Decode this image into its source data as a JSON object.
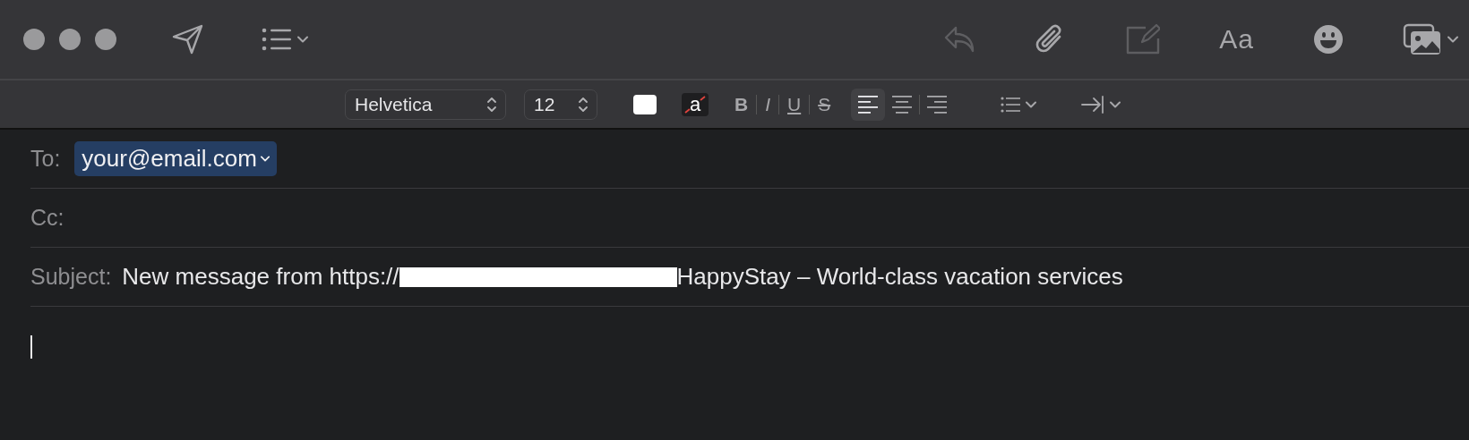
{
  "toolbar": {
    "left": [
      {
        "kind": "send",
        "disabled": false
      },
      {
        "kind": "header-fields",
        "disabled": false
      }
    ],
    "right": [
      {
        "kind": "reply",
        "disabled": true
      },
      {
        "kind": "attach",
        "disabled": false
      },
      {
        "kind": "markup",
        "disabled": true
      },
      {
        "kind": "fonts",
        "label": "Aa",
        "disabled": false
      },
      {
        "kind": "emoji",
        "disabled": false
      },
      {
        "kind": "photos",
        "disabled": false
      }
    ]
  },
  "format_bar": {
    "font": "Helvetica",
    "size": "12",
    "highlight_label": "a",
    "styles": [
      {
        "kind": "bold",
        "label": "B"
      },
      {
        "kind": "italic",
        "label": "I"
      },
      {
        "kind": "underline",
        "label": "U"
      },
      {
        "kind": "strike",
        "label": "S"
      }
    ],
    "alignments": [
      {
        "kind": "left",
        "selected": true
      },
      {
        "kind": "center",
        "selected": false
      },
      {
        "kind": "right",
        "selected": false
      }
    ]
  },
  "headers": [
    {
      "kind": "recipients",
      "label": "To:",
      "tokens": [
        "your@email.com"
      ]
    },
    {
      "kind": "recipients",
      "label": "Cc:"
    },
    {
      "kind": "subject",
      "label": "Subject:",
      "before": "New message from https://",
      "redacted": true,
      "after": "HappyStay – World-class vacation services"
    }
  ],
  "body": {
    "cursor": true
  }
}
